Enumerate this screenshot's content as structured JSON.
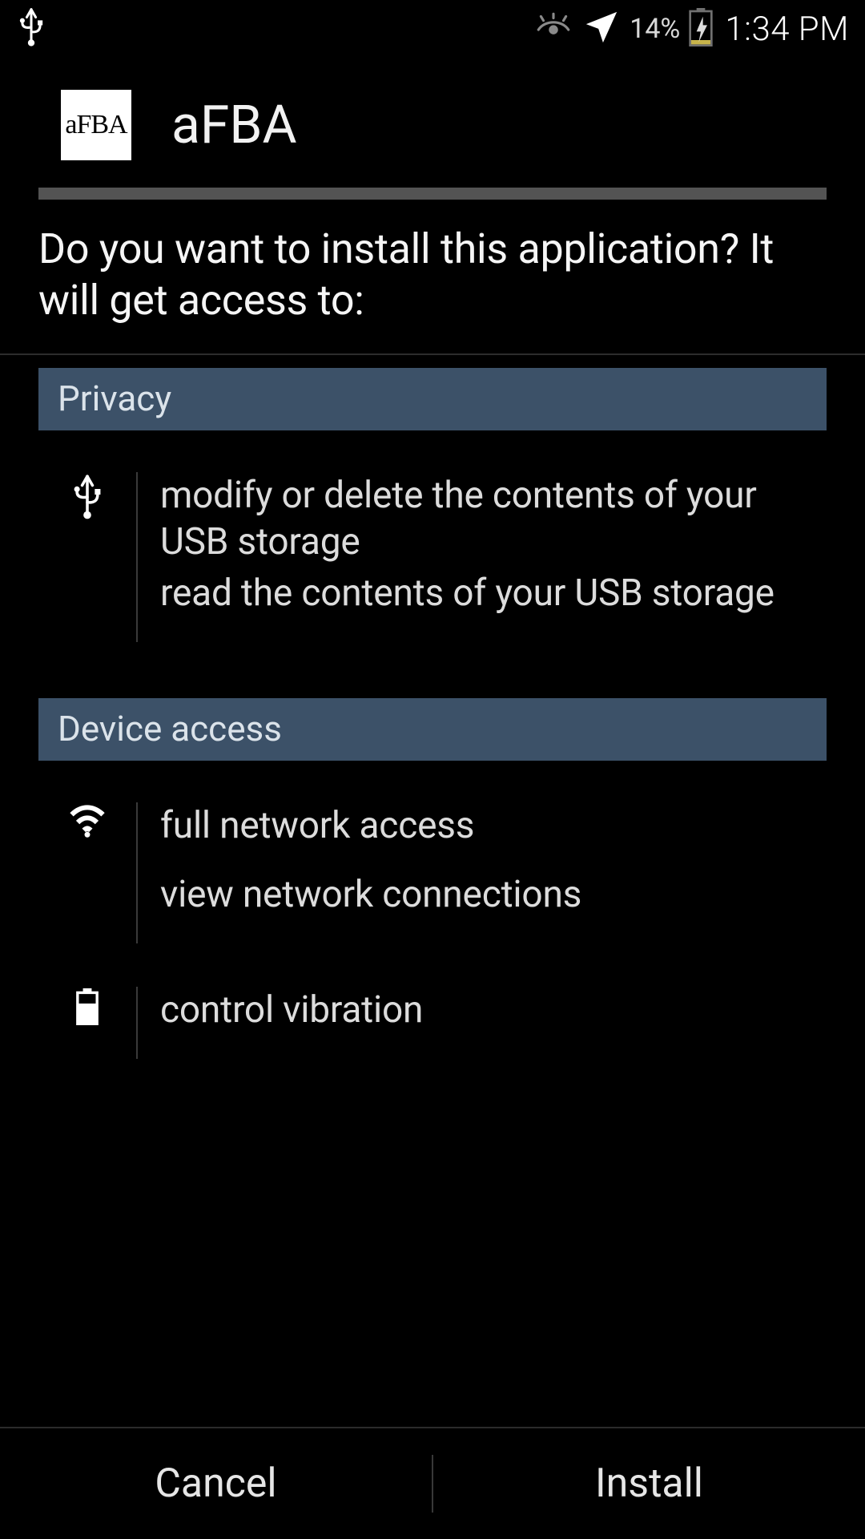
{
  "statusbar": {
    "battery_pct": "14%",
    "time": "1:34 PM"
  },
  "app": {
    "icon_text": "aFBA",
    "name": "aFBA"
  },
  "prompt": "Do you want to install this application? It will get access to:",
  "sections": [
    {
      "title": "Privacy",
      "groups": [
        {
          "icon": "usb",
          "lines": [
            "modify or delete the contents of your USB storage",
            "read the contents of your USB storage"
          ]
        }
      ]
    },
    {
      "title": "Device access",
      "groups": [
        {
          "icon": "wifi",
          "lines": [
            "full network access",
            "view network connections"
          ]
        },
        {
          "icon": "battery",
          "lines": [
            "control vibration"
          ]
        }
      ]
    }
  ],
  "buttons": {
    "cancel": "Cancel",
    "install": "Install"
  }
}
